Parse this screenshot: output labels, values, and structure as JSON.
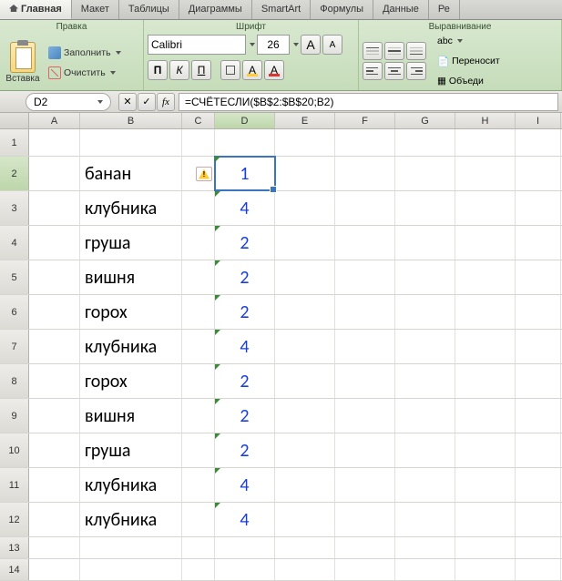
{
  "tabs": [
    "Главная",
    "Макет",
    "Таблицы",
    "Диаграммы",
    "SmartArt",
    "Формулы",
    "Данные",
    "Ре"
  ],
  "active_tab": 0,
  "ribbon": {
    "edit": {
      "title": "Правка",
      "paste": "Вставка",
      "fill": "Заполнить",
      "clear": "Очистить"
    },
    "font": {
      "title": "Шрифт",
      "name": "Calibri",
      "size": "26",
      "bold": "П",
      "italic": "К",
      "underline": "П",
      "grow": "A",
      "shrink": "A",
      "fontcolor": "A",
      "fillcolor": "A"
    },
    "align": {
      "title": "Выравнивание",
      "abc": "abc",
      "wrap": "Переносит",
      "merge": "Объеди"
    }
  },
  "namebox": "D2",
  "formula": "=СЧЁТЕСЛИ($B$2:$B$20;B2)",
  "columns": [
    "A",
    "B",
    "C",
    "D",
    "E",
    "F",
    "G",
    "H",
    "I"
  ],
  "sel_col": "D",
  "sel_row": 2,
  "row_heights": {
    "1": 30,
    "default": 38,
    "13": 24,
    "14": 24
  },
  "rows": [
    {
      "n": 1
    },
    {
      "n": 2,
      "b": "банан",
      "d": "1",
      "warn": true
    },
    {
      "n": 3,
      "b": "клубника",
      "d": "4"
    },
    {
      "n": 4,
      "b": "груша",
      "d": "2"
    },
    {
      "n": 5,
      "b": "вишня",
      "d": "2"
    },
    {
      "n": 6,
      "b": "горох",
      "d": "2"
    },
    {
      "n": 7,
      "b": "клубника",
      "d": "4"
    },
    {
      "n": 8,
      "b": "горох",
      "d": "2"
    },
    {
      "n": 9,
      "b": "вишня",
      "d": "2"
    },
    {
      "n": 10,
      "b": "груша",
      "d": "2"
    },
    {
      "n": 11,
      "b": "клубника",
      "d": "4"
    },
    {
      "n": 12,
      "b": "клубника",
      "d": "4"
    },
    {
      "n": 13
    },
    {
      "n": 14
    }
  ]
}
